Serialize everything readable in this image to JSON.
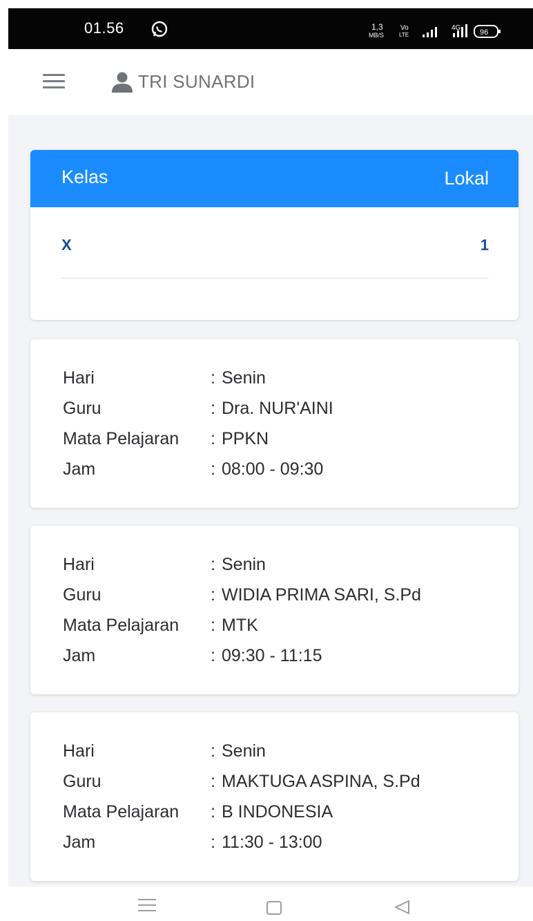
{
  "status_bar": {
    "time": "01.56",
    "speed_value": "1,3",
    "speed_unit": "MB/S",
    "volte_top": "Vo",
    "volte_bottom": "LTE",
    "network": "4G",
    "battery": "96"
  },
  "header": {
    "user_name": "TRI SUNARDI"
  },
  "kelas_card": {
    "header_left": "Kelas",
    "header_right": "Lokal",
    "kelas_value": "X",
    "lokal_value": "1"
  },
  "labels": {
    "hari": "Hari",
    "guru": "Guru",
    "mapel": "Mata Pelajaran",
    "jam": "Jam",
    "separator": ":"
  },
  "schedule": [
    {
      "hari": "Senin",
      "guru": "Dra. NUR'AINI",
      "mapel": "PPKN",
      "jam": "08:00 - 09:30"
    },
    {
      "hari": "Senin",
      "guru": "WIDIA PRIMA SARI, S.Pd",
      "mapel": "MTK",
      "jam": "09:30 - 11:15"
    },
    {
      "hari": "Senin",
      "guru": "MAKTUGA ASPINA, S.Pd",
      "mapel": "B INDONESIA",
      "jam": "11:30 - 13:00"
    }
  ],
  "colors": {
    "accent": "#1a8cff",
    "kelas_text": "#104f9f",
    "page_bg": "#f3f4f7"
  }
}
